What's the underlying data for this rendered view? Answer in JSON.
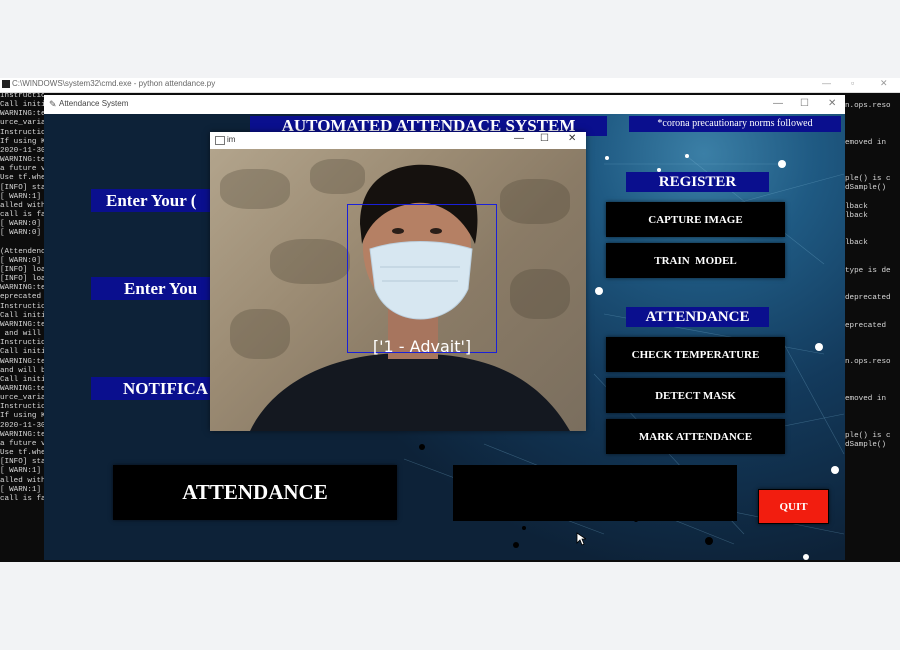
{
  "cmd_window": {
    "title": "C:\\WINDOWS\\system32\\cmd.exe - python  attendance.py",
    "left_lines": [
      "Instructions for updating:",
      "Call initi",
      "WARNING:te",
      "urce_varia",
      "Instructio",
      "If using K",
      "2020-11-30",
      "WARNING:te",
      "a future v",
      "Use tf.whe",
      "[INFO] sta",
      "[ WARN:1] ",
      "alled with",
      "call is fa",
      "[ WARN:0] ",
      "[ WARN:0] ",
      "",
      "(Attendenc",
      "[ WARN:0] ",
      "[INFO] loa",
      "[INFO] loa",
      "WARNING:te",
      "eprecated a",
      "Instructio",
      "Call initi",
      "WARNING:te",
      " and will ",
      "Instructio",
      "Call initi",
      "WARNING:te",
      "and will b",
      "Call initi",
      "WARNING:te",
      "urce_varia",
      "Instructio",
      "If using K",
      "2020-11-30",
      "WARNING:te",
      "a future v",
      "Use tf.whe",
      "[INFO] sta",
      "[ WARN:1] ",
      "alled with",
      "[ WARN:1] ",
      "call is fa"
    ],
    "right_lines": [
      "n.ops.reso",
      "",
      "",
      "",
      "emoved in",
      "",
      "",
      "",
      "ple() is c",
      "dSample()",
      "",
      "lback",
      "lback",
      "",
      "",
      "lback",
      "",
      "",
      "type is de",
      "",
      "",
      "deprecated",
      "",
      "",
      "eprecated",
      "",
      "",
      "",
      "n.ops.reso",
      "",
      "",
      "",
      "emoved in",
      "",
      "",
      "",
      "ple() is c",
      "dSample()"
    ]
  },
  "app_window": {
    "title": "Attendance System",
    "heading": "AUTOMATED ATTENDACE SYSTEM",
    "notice": "*corona precautionary norms followed",
    "labels": {
      "enter_id": "Enter Your (",
      "enter_name": "Enter You",
      "notification": "NOTIFICA"
    },
    "section_register": "REGISTER",
    "btn_capture": "CAPTURE IMAGE",
    "btn_train": "TRAIN  MODEL",
    "section_attendance": "ATTENDANCE",
    "btn_temperature": "CHECK TEMPERATURE",
    "btn_mask": "DETECT MASK",
    "btn_mark": "MARK ATTENDANCE",
    "btn_attendance_big": "ATTENDANCE",
    "btn_quit": "QUIT",
    "quit_color": "#f21d0f"
  },
  "camera_window": {
    "title": "im",
    "face_label": "['1 - Advait']",
    "box_color": "#1a20d9"
  }
}
